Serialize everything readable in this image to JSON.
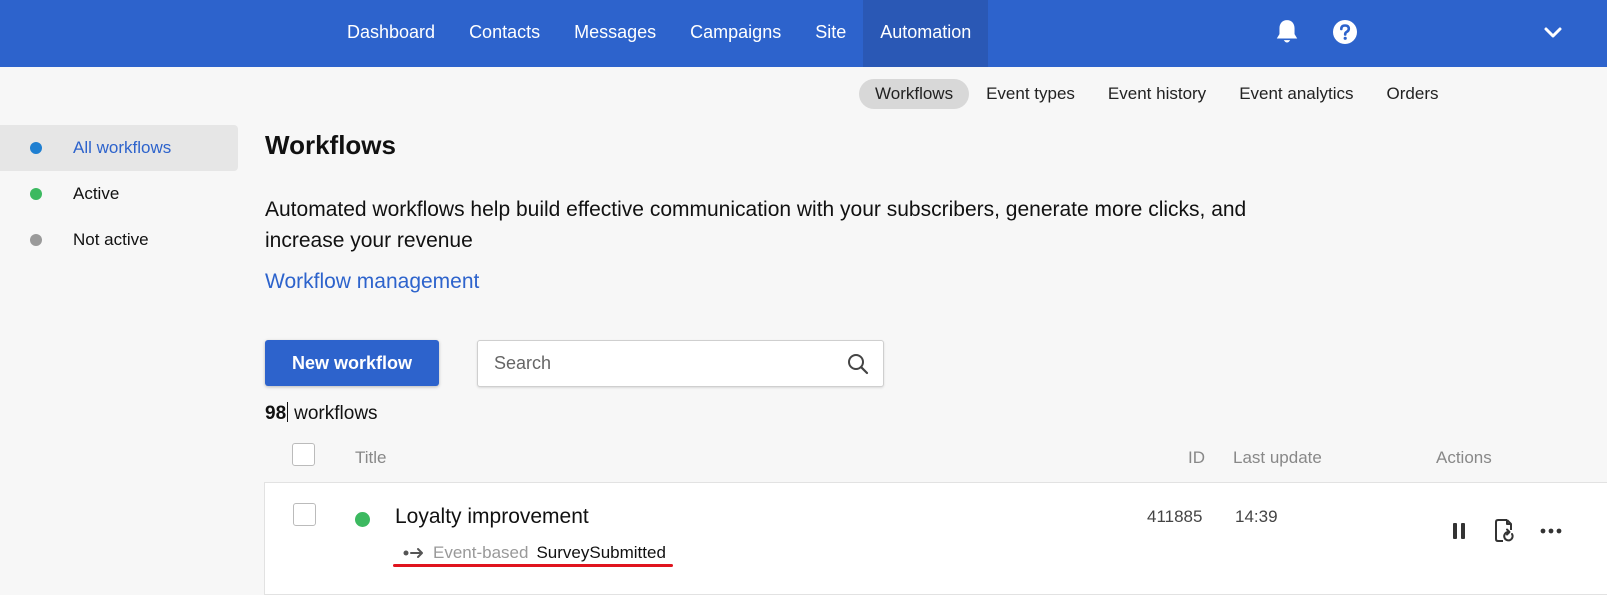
{
  "nav": {
    "items": [
      {
        "label": "Dashboard"
      },
      {
        "label": "Contacts"
      },
      {
        "label": "Messages"
      },
      {
        "label": "Campaigns"
      },
      {
        "label": "Site"
      },
      {
        "label": "Automation"
      }
    ],
    "active": "Automation",
    "icons": [
      "bell-icon",
      "help-icon",
      "chevron-down-icon"
    ]
  },
  "subnav": {
    "items": [
      {
        "label": "Workflows"
      },
      {
        "label": "Event types"
      },
      {
        "label": "Event history"
      },
      {
        "label": "Event analytics"
      },
      {
        "label": "Orders"
      }
    ],
    "active": "Workflows"
  },
  "sidebar": {
    "items": [
      {
        "label": "All workflows",
        "dot_color": "#1f7fd1"
      },
      {
        "label": "Active",
        "dot_color": "#3cb960"
      },
      {
        "label": "Not active",
        "dot_color": "#9a9a9a"
      }
    ],
    "active": "All workflows"
  },
  "main": {
    "title": "Workflows",
    "description": "Automated workflows help build effective communication with your subscribers, generate more clicks, and increase your revenue",
    "management_link": "Workflow management",
    "new_button": "New workflow",
    "search_placeholder": "Search",
    "count_number": "98",
    "count_label": "workflows"
  },
  "table": {
    "headers": {
      "title": "Title",
      "id": "ID",
      "last_update": "Last update",
      "actions": "Actions"
    },
    "rows": [
      {
        "title": "Loyalty improvement",
        "status": "active",
        "status_color": "#3cb960",
        "type_label": "Event-based",
        "event_name": "SurveySubmitted",
        "id": "411885",
        "last_update": "14:39",
        "actions": [
          "pause-icon",
          "restart-icon",
          "more-icon"
        ]
      }
    ]
  },
  "colors": {
    "brand": "#2d63cc",
    "highlight_underline": "#e0141e"
  }
}
